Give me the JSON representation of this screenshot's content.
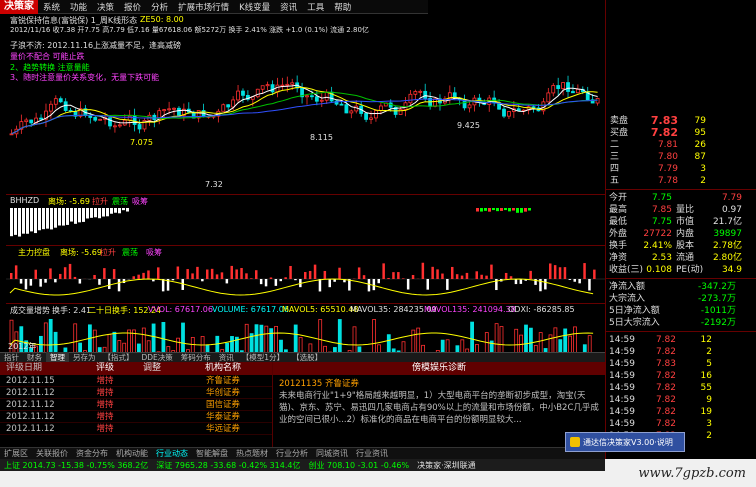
{
  "app": {
    "logo": "决策家",
    "menu": [
      "系统",
      "功能",
      "决策",
      "报价",
      "分析",
      "扩展市场行情",
      "K线变量",
      "资讯",
      "工具",
      "帮助"
    ]
  },
  "chart": {
    "title": "富锐保持信息(富锐保) 1_周K线形态",
    "info_line": "2012/11/16 收7.38 开7.75 高7.79 低7.16 量67618.06 额5272万 换手 2.41% 涨跌 +1.0 (0.1%) 流通 2.80亿",
    "ma_label": "ZE50: 8.00",
    "annot1": "子浪不济: 2012.11.16上涨减量不足，逢高减磅",
    "annot2": "量价不配合 可能止跌",
    "annot3": "2、趋势转换 注意量能",
    "annot4": "3、随时注意量价关系变化，无量下跌可能",
    "price_labels": [
      "8.115",
      "9.425",
      "7.075",
      "7.32"
    ],
    "panel2_title": "离场: -5.69",
    "panel2_extra": [
      "拉升",
      "震荡",
      "吸筹"
    ],
    "panel3_title": "主力控盘",
    "panel3_values": [
      "离场: -5.69",
      "拉升",
      "震荡",
      "吸筹"
    ],
    "panel4_label": "成交量增势",
    "panel4_values": [
      "换手: 2.41",
      "二十日换手: 152.24",
      "VVOL: 67617.06",
      "VOLUME: 67617.06",
      "MAVOL5: 65510.48",
      "MAVOL35: 284235.09",
      "MAVOL135: 241094.38",
      "ODXI: -86285.85"
    ],
    "side_labels": [
      "0.00",
      "7.5",
      "8.0"
    ],
    "date_label": "2012年"
  },
  "tabs": [
    {
      "label": "指针",
      "active": false
    },
    {
      "label": "财务",
      "active": false
    },
    {
      "label": "智理",
      "active": true
    },
    {
      "label": "另存为",
      "active": false
    },
    {
      "label": "【指式】",
      "active": false
    },
    {
      "label": "DDE决策",
      "active": false
    },
    {
      "label": "筹码分布",
      "active": false
    },
    {
      "label": "资讯",
      "active": false
    },
    {
      "label": "【模型1分】",
      "active": false
    },
    {
      "label": "【选股】",
      "active": false
    }
  ],
  "table": {
    "headers": [
      "评级日期",
      "评级",
      "调整",
      "机构名称"
    ],
    "rows": [
      {
        "date": "2012.11.15",
        "rating": "增持",
        "adj": "",
        "org": "齐鲁证券"
      },
      {
        "date": "2012.11.12",
        "rating": "增持",
        "adj": "",
        "org": "华创证券"
      },
      {
        "date": "2012.11.12",
        "rating": "增持",
        "adj": "",
        "org": "国信证券"
      },
      {
        "date": "2012.11.12",
        "rating": "增持",
        "adj": "",
        "org": "华泰证券"
      },
      {
        "date": "2012.11.12",
        "rating": "增持",
        "adj": "",
        "org": "华远证券"
      }
    ]
  },
  "diagnosis": {
    "header": "傍模娱乐诊断",
    "date_line": "20121135 齐鲁证券",
    "text": "未来电商行业\"1+9\"格局越来越明显，1）大型电商平台的垄断初步成型，淘宝(天猫)、京东、苏宁、易迅四几家电商占有90%以上的流量和市场份额，中小B2C几乎成业的空间已很小...2）标准化的商品在电商平台的份额明显较大...",
    "subtitle": "傍模娱乐"
  },
  "orderbook": {
    "sell_label": "卖盘",
    "buy_label": "买盘",
    "sell_price": "7.83",
    "sell_vol": "79",
    "buy_price": "7.82",
    "buy_vol": "95",
    "levels": [
      {
        "label": "二",
        "price": "7.81",
        "vol": "26"
      },
      {
        "label": "三",
        "price": "7.80",
        "vol": "87"
      },
      {
        "label": "四",
        "price": "7.79",
        "vol": "3"
      },
      {
        "label": "五",
        "price": "7.78",
        "vol": "2"
      }
    ]
  },
  "stats": [
    {
      "l1": "今开",
      "v1": "7.75",
      "l2": "",
      "v2": "7.79"
    },
    {
      "l1": "最高",
      "v1": "7.85",
      "l2": "量比",
      "v2": "0.97"
    },
    {
      "l1": "最低",
      "v1": "7.75",
      "l2": "市值",
      "v2": "21.7亿"
    },
    {
      "l1": "外盘",
      "v1": "27722",
      "l2": "内盘",
      "v2": "39897"
    },
    {
      "l1": "换手",
      "v1": "2.41%",
      "l2": "股本",
      "v2": "2.78亿"
    },
    {
      "l1": "净资",
      "v1": "2.53",
      "l2": "流通",
      "v2": "2.80亿"
    },
    {
      "l1": "收益(三)",
      "v1": "0.108",
      "l2": "PE(动)",
      "v2": "34.9"
    }
  ],
  "flows": [
    {
      "label": "净流入额",
      "value": "-347.2万"
    },
    {
      "label": "大宗流入",
      "value": "-273.7万"
    },
    {
      "label": "5日净流入额",
      "value": "-1011万"
    },
    {
      "label": "5日大宗流入",
      "value": "-2192万"
    }
  ],
  "ticks": [
    {
      "t": "14:59",
      "p": "7.82",
      "v": "12"
    },
    {
      "t": "14:59",
      "p": "7.82",
      "v": "2"
    },
    {
      "t": "14:59",
      "p": "7.83",
      "v": "5"
    },
    {
      "t": "14:59",
      "p": "7.82",
      "v": "16"
    },
    {
      "t": "14:59",
      "p": "7.82",
      "v": "55"
    },
    {
      "t": "14:59",
      "p": "7.82",
      "v": "9"
    },
    {
      "t": "14:59",
      "p": "7.82",
      "v": "19"
    },
    {
      "t": "14:59",
      "p": "7.82",
      "v": "3"
    },
    {
      "t": "14:59",
      "p": "7.82",
      "v": "2"
    }
  ],
  "funcbar": [
    "扩展区",
    "关联报价",
    "资金分布",
    "机构动能",
    "行业动态",
    "智能解盘",
    "热点题材",
    "行业分析",
    "同城资讯",
    "行业资讯"
  ],
  "status": {
    "market1": "上证 2014.73 -15.38 -0.75% 368.2亿",
    "market2": "深证 7965.28 -33.68 -0.42% 314.4亿",
    "market3": "创业 708.10 -3.01 -0.46%",
    "market4": "决策家·深圳联通",
    "popup": "通达信决策家V3.00·说明",
    "watermark": "www.7gpzb.com"
  },
  "colors": {
    "up": "#ff4040",
    "down": "#00ffff",
    "ma_yellow": "#ffff00",
    "ma_green": "#00c000",
    "ma_blue": "#3050ff",
    "accent_red": "#c00000"
  }
}
